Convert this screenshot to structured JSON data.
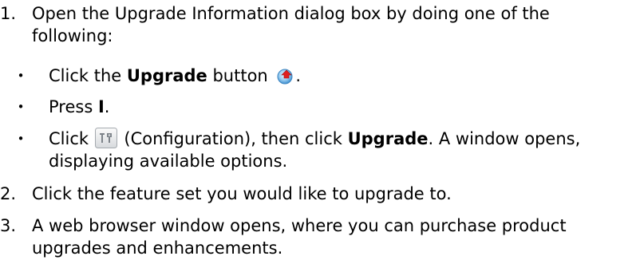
{
  "steps": [
    {
      "number": "1.",
      "line1": "Open the Upgrade Information dialog box by doing one of the",
      "line2": "following:"
    },
    {
      "number": "2.",
      "text": "Click the feature set you would like to upgrade to."
    },
    {
      "number": "3.",
      "line1": "A web browser window opens, where you can purchase product",
      "line2": "upgrades and enhancements."
    }
  ],
  "bullets": [
    {
      "pre": "Click the ",
      "bold": "Upgrade",
      "post": " button",
      "end": ".",
      "icon": "upgrade-icon"
    },
    {
      "pre": "Press ",
      "bold": "I",
      "post": "."
    },
    {
      "pre": "Click ",
      "mid": " (Configuration), then click ",
      "bold": "Upgrade",
      "post": ". A window opens,",
      "line2": "displaying available options.",
      "icon": "configuration-icon"
    }
  ],
  "bullet_glyph": "•",
  "colors": {
    "text": "#000000",
    "upgrade_icon_blue": "#4a9fd8",
    "upgrade_icon_red": "#e02020",
    "config_icon_gray": "#8a8f95"
  }
}
